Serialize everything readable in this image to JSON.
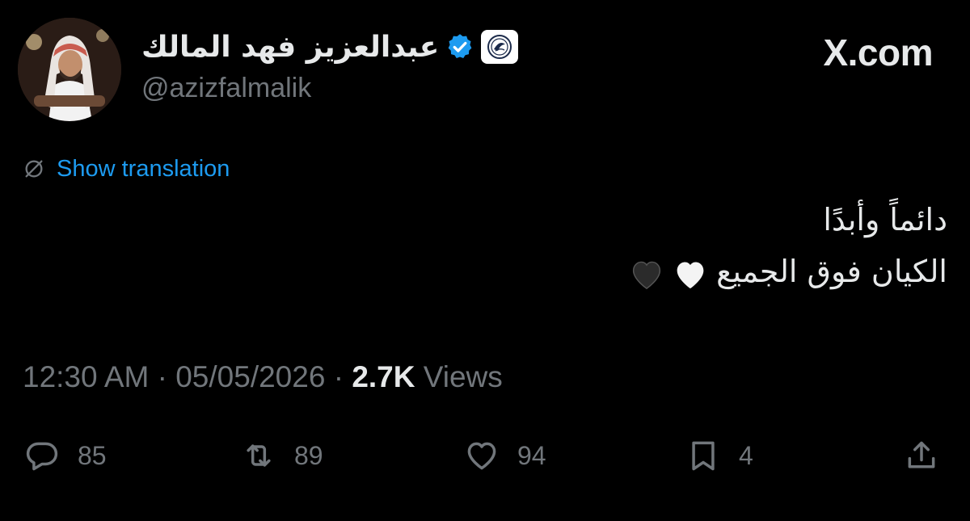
{
  "header": {
    "display_name": "عبدالعزيز فهد المالك",
    "handle": "@azizfalmalik",
    "verified": true,
    "site_label": "X.com"
  },
  "translation": {
    "label": "Show translation",
    "icon": "globe-slash-icon"
  },
  "tweet": {
    "lines": [
      "دائماً وأبدًا",
      "الكيان فوق الجميع"
    ],
    "emoji": [
      "white-heart",
      "black-heart"
    ]
  },
  "meta": {
    "time": "12:30 AM",
    "separator": "·",
    "date": "05/05/2026",
    "views_count": "2.7K",
    "views_label": "Views"
  },
  "actions": {
    "replies": "85",
    "reposts": "89",
    "likes": "94",
    "bookmarks": "4"
  },
  "colors": {
    "background": "#000000",
    "text": "#e7e9ea",
    "secondary": "#71767b",
    "accent": "#1d9bf0"
  }
}
